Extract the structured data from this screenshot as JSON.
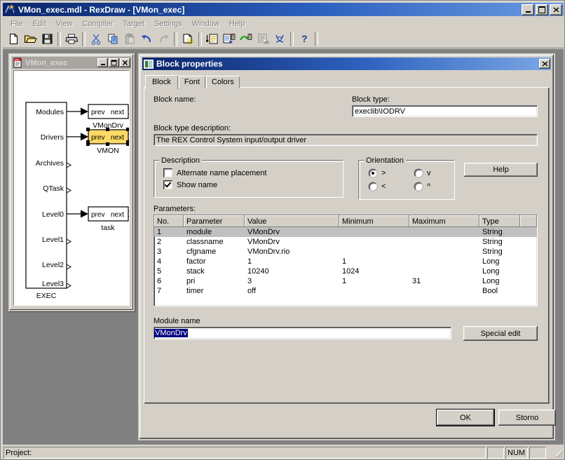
{
  "window": {
    "title": "VMon_exec.mdl - RexDraw - [VMon_exec]",
    "icon": "rexdraw-app-icon",
    "minimize_label": "_",
    "maximize_label": "□",
    "close_label": "✕"
  },
  "menu": {
    "items": [
      {
        "label": "File"
      },
      {
        "label": "Edit"
      },
      {
        "label": "View"
      },
      {
        "label": "Compiler"
      },
      {
        "label": "Target"
      },
      {
        "label": "Settings"
      },
      {
        "label": "Window"
      },
      {
        "label": "Help"
      }
    ]
  },
  "toolbar": {
    "buttons": [
      {
        "name": "new-file-icon",
        "tooltip": "New"
      },
      {
        "name": "open-folder-icon",
        "tooltip": "Open"
      },
      {
        "name": "save-disk-icon",
        "tooltip": "Save"
      },
      {
        "name": "print-icon",
        "tooltip": "Print"
      },
      {
        "name": "cut-scissors-icon",
        "tooltip": "Cut"
      },
      {
        "name": "copy-icon",
        "tooltip": "Copy"
      },
      {
        "name": "paste-icon",
        "tooltip": "Paste"
      },
      {
        "name": "undo-arrow-icon",
        "tooltip": "Undo"
      },
      {
        "name": "redo-arrow-icon",
        "tooltip": "Redo"
      },
      {
        "name": "compile-icon",
        "tooltip": "Compile"
      },
      {
        "name": "download-document-icon",
        "tooltip": "Download"
      },
      {
        "name": "download-target-icon",
        "tooltip": "Download to target"
      },
      {
        "name": "connect-target-icon",
        "tooltip": "Connect"
      },
      {
        "name": "task-monitor-icon",
        "tooltip": "Task monitor"
      },
      {
        "name": "diagnostics-icon",
        "tooltip": "Diagnostics"
      },
      {
        "name": "help-question-icon",
        "tooltip": "Help"
      }
    ]
  },
  "mdi_child": {
    "title": "VMon_exec",
    "icon": "mdl-document-icon",
    "minimize_label": "_",
    "maximize_label": "□",
    "close_label": "✕",
    "diagram": {
      "exec_block_label": "EXEC",
      "ports": [
        {
          "label": "Modules",
          "connected": true
        },
        {
          "label": "Drivers",
          "connected": true
        },
        {
          "label": "Archives",
          "connected": false
        },
        {
          "label": "QTask",
          "connected": false
        },
        {
          "label": "Level0",
          "connected": true
        },
        {
          "label": "Level1",
          "connected": false
        },
        {
          "label": "Level2",
          "connected": false
        },
        {
          "label": "Level3",
          "connected": false
        }
      ],
      "blocks": [
        {
          "caption_left": "prev",
          "caption_right": "next",
          "name": "VMonDrv",
          "selected": false
        },
        {
          "caption_left": "prev",
          "caption_right": "next",
          "name": "VMON",
          "selected": true
        },
        {
          "caption_left": "prev",
          "caption_right": "next",
          "name": "task",
          "selected": false
        }
      ],
      "selection_color": "#ffd966"
    }
  },
  "dialog": {
    "title": "Block properties",
    "icon": "properties-window-icon",
    "close_label": "✕",
    "tabs": [
      {
        "label": "Block",
        "active": true
      },
      {
        "label": "Font",
        "active": false
      },
      {
        "label": "Colors",
        "active": false
      }
    ],
    "block_name_label": "Block name:",
    "block_name_value": "",
    "block_type_label": "Block type:",
    "block_type_value": "execlib\\IODRV",
    "block_type_description_label": "Block type description:",
    "block_type_description_value": "The REX Control System input/output driver",
    "description_group": {
      "title": "Description",
      "alternate_name_placement": {
        "label": "Alternate name placement",
        "checked": false
      },
      "show_name": {
        "label": "Show name",
        "checked": true
      }
    },
    "orientation_group": {
      "title": "Orientation",
      "options": [
        {
          "label": ">",
          "checked": true
        },
        {
          "label": "v",
          "checked": false
        },
        {
          "label": "<",
          "checked": false
        },
        {
          "label": "^",
          "checked": false
        }
      ]
    },
    "help_button": "Help",
    "parameters_label": "Parameters:",
    "parameters_table": {
      "columns": [
        "No.",
        "Parameter",
        "Value",
        "Minimum",
        "Maximum",
        "Type",
        ""
      ],
      "rows": [
        {
          "no": "1",
          "parameter": "module",
          "value": "VMonDrv",
          "minimum": "",
          "maximum": "",
          "type": "String",
          "selected": true
        },
        {
          "no": "2",
          "parameter": "classname",
          "value": "VMonDrv",
          "minimum": "",
          "maximum": "",
          "type": "String",
          "selected": false
        },
        {
          "no": "3",
          "parameter": "cfgname",
          "value": "VMonDrv.rio",
          "minimum": "",
          "maximum": "",
          "type": "String",
          "selected": false
        },
        {
          "no": "4",
          "parameter": "factor",
          "value": "1",
          "minimum": "1",
          "maximum": "",
          "type": "Long",
          "selected": false
        },
        {
          "no": "5",
          "parameter": "stack",
          "value": "10240",
          "minimum": "1024",
          "maximum": "",
          "type": "Long",
          "selected": false
        },
        {
          "no": "6",
          "parameter": "pri",
          "value": "3",
          "minimum": "1",
          "maximum": "31",
          "type": "Long",
          "selected": false
        },
        {
          "no": "7",
          "parameter": "timer",
          "value": "off",
          "minimum": "",
          "maximum": "",
          "type": "Bool",
          "selected": false
        }
      ]
    },
    "module_name_label": "Module name",
    "module_name_value": "VMonDrv",
    "special_edit_button": "Special edit",
    "ok_button": "OK",
    "cancel_button": "Storno"
  },
  "statusbar": {
    "project_label": "Project:",
    "indicator_caps": "",
    "indicator_num": "NUM",
    "indicator_scroll": ""
  },
  "colors": {
    "titlebar_start": "#0a246a",
    "titlebar_end": "#6a9ae0",
    "face": "#d4d0c8",
    "selection": "#c0c0c0",
    "text_selection": "#000080",
    "block_selected": "#ffd966",
    "mdi_inactive": "#a8a4a0"
  }
}
